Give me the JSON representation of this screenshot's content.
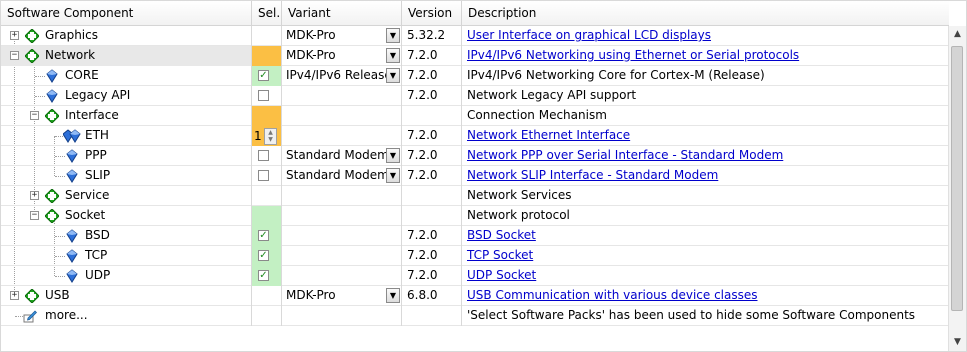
{
  "header": {
    "component": "Software Component",
    "sel": "Sel.",
    "variant": "Variant",
    "version": "Version",
    "description": "Description"
  },
  "rows": [
    {
      "name": "Graphics",
      "variant": "MDK-Pro",
      "version": "5.32.2",
      "description": "User Interface on graphical LCD displays"
    },
    {
      "name": "Network",
      "variant": "MDK-Pro",
      "version": "7.2.0",
      "description": "IPv4/IPv6 Networking using Ethernet or Serial protocols"
    },
    {
      "name": "CORE",
      "variant": "IPv4/IPv6 Release",
      "version": "7.2.0",
      "description": "IPv4/IPv6 Networking Core for Cortex-M (Release)",
      "selected": "✓"
    },
    {
      "name": "Legacy API",
      "variant": "",
      "version": "7.2.0",
      "description": "Network Legacy API support"
    },
    {
      "name": "Interface",
      "variant": "",
      "version": "",
      "description": "Connection Mechanism"
    },
    {
      "name": "ETH",
      "variant": "",
      "version": "7.2.0",
      "description": "Network Ethernet Interface",
      "count": "1"
    },
    {
      "name": "PPP",
      "variant": "Standard Modem",
      "version": "7.2.0",
      "description": "Network PPP over Serial Interface - Standard Modem"
    },
    {
      "name": "SLIP",
      "variant": "Standard Modem",
      "version": "7.2.0",
      "description": "Network SLIP Interface - Standard Modem"
    },
    {
      "name": "Service",
      "variant": "",
      "version": "",
      "description": "Network Services"
    },
    {
      "name": "Socket",
      "variant": "",
      "version": "",
      "description": "Network protocol"
    },
    {
      "name": "BSD",
      "variant": "",
      "version": "7.2.0",
      "description": "BSD Socket",
      "selected": "✓"
    },
    {
      "name": "TCP",
      "variant": "",
      "version": "7.2.0",
      "description": "TCP Socket",
      "selected": "✓"
    },
    {
      "name": "UDP",
      "variant": "",
      "version": "7.2.0",
      "description": "UDP Socket",
      "selected": "✓"
    },
    {
      "name": "USB",
      "variant": "MDK-Pro",
      "version": "6.8.0",
      "description": "USB Communication with various device classes"
    },
    {
      "name": "more...",
      "variant": "",
      "version": "",
      "description": "'Select Software Packs' has been used to hide some Software Components"
    }
  ],
  "colors": {
    "orange": "#fbbf44",
    "green": "#c3f0c3",
    "link": "#0000cc"
  },
  "icons": {
    "expand": "plus-box-icon",
    "collapse": "minus-box-icon",
    "group": "green-diamond-icon",
    "component": "blue-gem-icon",
    "more": "pencil-box-icon"
  }
}
